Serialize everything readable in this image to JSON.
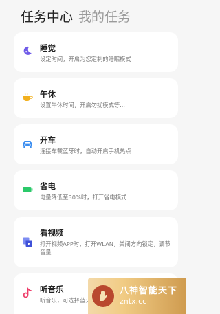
{
  "header": {
    "active_tab": "任务中心",
    "inactive_tab": "我的任务"
  },
  "tasks": [
    {
      "title": "睡觉",
      "desc": "设定时间，开启为您定制的睡眠模式",
      "icon": "moon-icon",
      "color": "#6f5be8"
    },
    {
      "title": "午休",
      "desc": "设置午休时间，开启勿扰模式等...",
      "icon": "cup-icon",
      "color": "#f2b01e"
    },
    {
      "title": "开车",
      "desc": "连接车载蓝牙时，自动开启手机热点",
      "icon": "car-icon",
      "color": "#3a8df0"
    },
    {
      "title": "省电",
      "desc": "电量降低至30%时，打开省电模式",
      "icon": "battery-icon",
      "color": "#2bc96a"
    },
    {
      "title": "看视频",
      "desc": "打开视频APP时，打开WLAN，关闭方向锁定，调节音量",
      "icon": "video-icon",
      "color": "#4a5de0"
    },
    {
      "title": "听音乐",
      "desc": "听音乐，可选择蓝牙耳机或扬声器",
      "icon": "music-icon",
      "color": "#ee3d6a"
    }
  ],
  "watermark": {
    "name": "八神智能天下",
    "url": "zntx.cc"
  }
}
